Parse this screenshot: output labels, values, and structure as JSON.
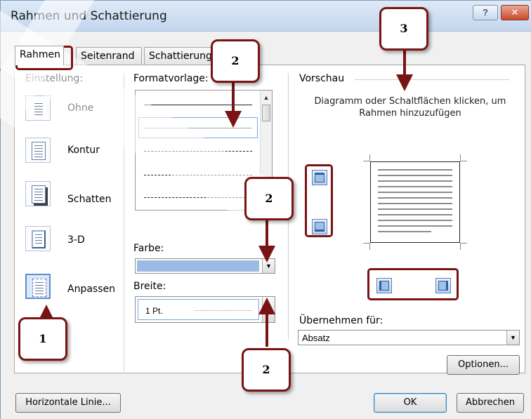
{
  "window": {
    "title": "Rahmen und Schattierung",
    "help": "?",
    "close": "✕"
  },
  "tabs": [
    {
      "label": "Rahmen"
    },
    {
      "label": "Seitenrand"
    },
    {
      "label": "Schattierung"
    }
  ],
  "einstellung": {
    "header": "Einstellung:",
    "items": [
      {
        "label": "Ohne"
      },
      {
        "label": "Kontur"
      },
      {
        "label": "Schatten"
      },
      {
        "label": "3-D"
      },
      {
        "label": "Anpassen"
      }
    ]
  },
  "formatvorlage": {
    "header": "Formatvorlage:"
  },
  "farbe": {
    "label": "Farbe:",
    "value_color": "#9bbbe4"
  },
  "breite": {
    "label": "Breite:",
    "value": "1 Pt."
  },
  "preview": {
    "header": "Vorschau",
    "hint": "Diagramm oder Schaltflächen klicken, um Rahmen hinzuzufügen"
  },
  "apply": {
    "label": "Übernehmen für:",
    "value": "Absatz"
  },
  "buttons": {
    "options": "Optionen...",
    "horizontal": "Horizontale Linie...",
    "ok": "OK",
    "cancel": "Abbrechen"
  },
  "annotations": {
    "c1": "1",
    "c2a": "2",
    "c2b": "2",
    "c2c": "2",
    "c3": "3",
    "color": "#7a1414"
  }
}
